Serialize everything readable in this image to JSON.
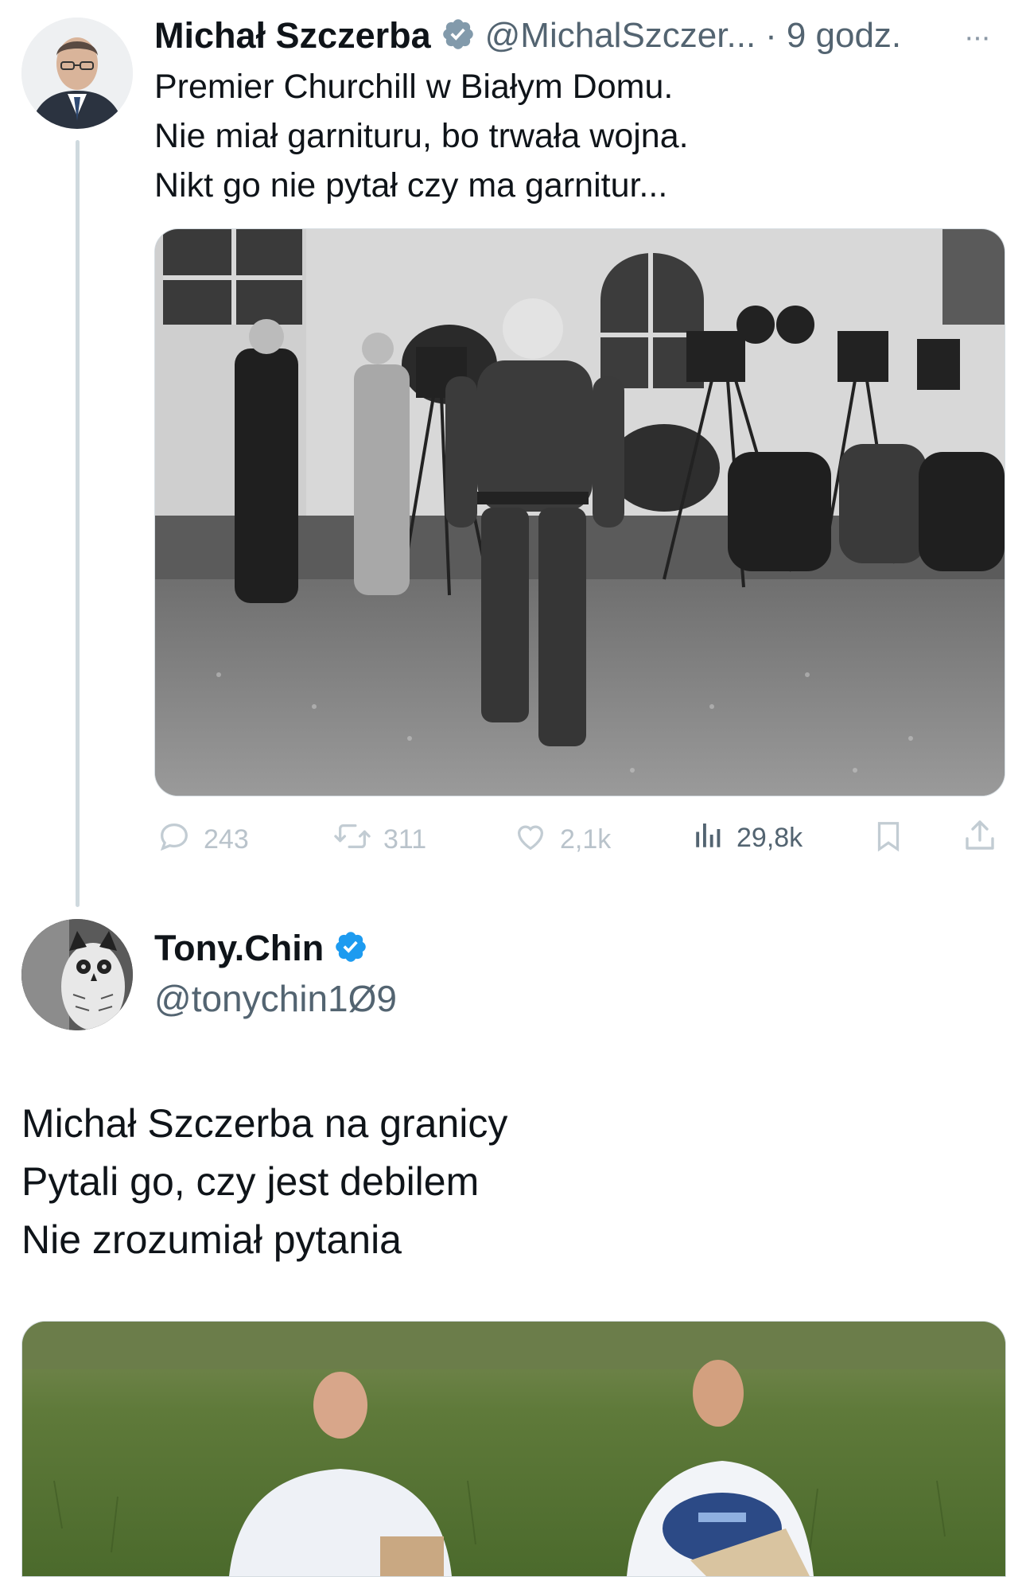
{
  "tweet": {
    "author_name": "Michał Szczerba",
    "handle": "@MichalSzczer...",
    "separator": "·",
    "time": "9 godz.",
    "more_label": "···",
    "lines": [
      "Premier Churchill w Białym Domu.",
      "Nie miał garnituru, bo trwała wojna.",
      "Nikt go nie pytał czy ma garnitur..."
    ],
    "actions": {
      "replies": "243",
      "retweets": "311",
      "likes": "2,1k",
      "views": "29,8k"
    }
  },
  "reply": {
    "author_name": "Tony.Chin",
    "handle": "@tonychin1Ø9",
    "lines": [
      "Michał Szczerba na granicy",
      "Pytali go, czy jest debilem",
      "Nie zrozumiał pytania"
    ]
  },
  "colors": {
    "verified": "#1d9bf0",
    "gray_verified": "#829aab",
    "secondary_text": "#536471"
  }
}
